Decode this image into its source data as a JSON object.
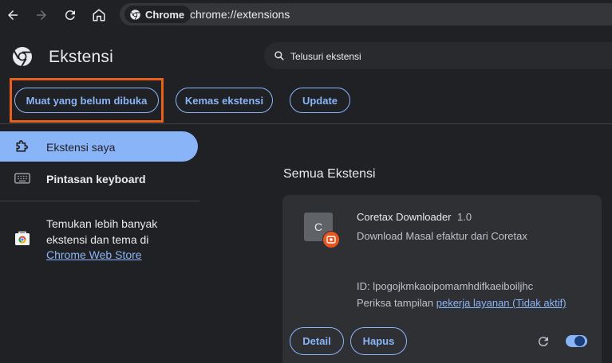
{
  "browser": {
    "chip_label": "Chrome",
    "url": "chrome://extensions"
  },
  "header": {
    "title": "Ekstensi",
    "search_placeholder": "Telusuri ekstensi"
  },
  "toolbar": {
    "load_unpacked_label": "Muat yang belum dibuka",
    "pack_label": "Kemas ekstensi",
    "update_label": "Update",
    "highlight_color": "#e8601c"
  },
  "sidebar": {
    "items": [
      {
        "label": "Ekstensi saya",
        "icon": "extension-puzzle-icon",
        "selected": true
      },
      {
        "label": "Pintasan keyboard",
        "icon": "keyboard-icon",
        "selected": false
      }
    ],
    "store_text": "Temukan lebih banyak ekstensi dan tema di",
    "store_link": "Chrome Web Store"
  },
  "main": {
    "section_title": "Semua Ekstensi",
    "extension": {
      "icon_letter": "C",
      "name": "Coretax Downloader",
      "version": "1.0",
      "description": "Download Masal efaktur dari Coretax",
      "id_text": "ID: lpogojkmkaoipomamhdifkaeiboiljhc",
      "inspect_prefix": "Periksa tampilan",
      "inspect_link": "pekerja layanan (Tidak aktif)",
      "details_label": "Detail",
      "remove_label": "Hapus",
      "enabled": true
    }
  },
  "colors": {
    "accent": "#8ab4f8",
    "background": "#202124",
    "card": "#2f3034"
  }
}
